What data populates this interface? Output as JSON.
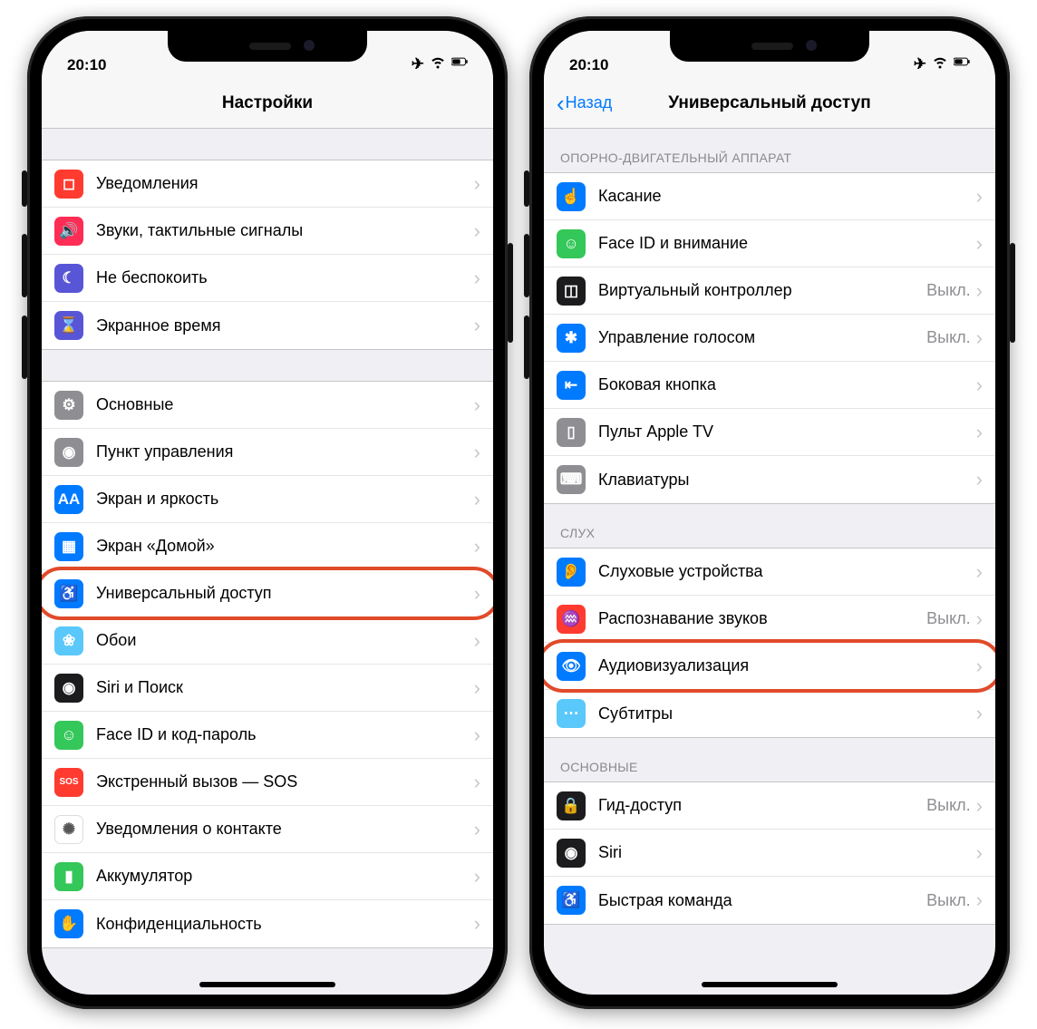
{
  "status": {
    "time": "20:10"
  },
  "left": {
    "nav_title": "Настройки",
    "group1": [
      {
        "icon": "notifications-icon",
        "color": "c-red",
        "label": "Уведомления",
        "glyph": "◻"
      },
      {
        "icon": "sounds-icon",
        "color": "c-pink",
        "label": "Звуки, тактильные сигналы",
        "glyph": "🔊"
      },
      {
        "icon": "dnd-icon",
        "color": "c-purple",
        "label": "Не беспокоить",
        "glyph": "☾"
      },
      {
        "icon": "screentime-icon",
        "color": "c-purple",
        "label": "Экранное время",
        "glyph": "⌛"
      }
    ],
    "group2": [
      {
        "icon": "general-icon",
        "color": "c-gray",
        "label": "Основные",
        "glyph": "⚙"
      },
      {
        "icon": "control-center-icon",
        "color": "c-gray",
        "label": "Пункт управления",
        "glyph": "◉"
      },
      {
        "icon": "display-icon",
        "color": "c-blue",
        "label": "Экран и яркость",
        "glyph": "AA"
      },
      {
        "icon": "homescreen-icon",
        "color": "c-blue",
        "label": "Экран «Домой»",
        "glyph": "▦"
      },
      {
        "icon": "accessibility-icon",
        "color": "c-blue",
        "label": "Универсальный доступ",
        "glyph": "♿",
        "circled": true
      },
      {
        "icon": "wallpaper-icon",
        "color": "c-teal",
        "label": "Обои",
        "glyph": "❀"
      },
      {
        "icon": "siri-icon",
        "color": "c-dark",
        "label": "Siri и Поиск",
        "glyph": "◉"
      },
      {
        "icon": "faceid-icon",
        "color": "c-green",
        "label": "Face ID и код-пароль",
        "glyph": "☺"
      },
      {
        "icon": "sos-icon",
        "color": "c-red",
        "label": "Экстренный вызов — SOS",
        "glyph": "SOS"
      },
      {
        "icon": "exposure-icon",
        "color": "c-white",
        "label": "Уведомления о контакте",
        "glyph": "✺"
      },
      {
        "icon": "battery-icon",
        "color": "c-green",
        "label": "Аккумулятор",
        "glyph": "▮"
      },
      {
        "icon": "privacy-icon",
        "color": "c-blue",
        "label": "Конфиденциальность",
        "glyph": "✋"
      }
    ]
  },
  "right": {
    "nav_back": "Назад",
    "nav_title": "Универсальный доступ",
    "section1_header": "Опорно-двигательный аппарат",
    "section1": [
      {
        "icon": "touch-icon",
        "color": "c-blue",
        "label": "Касание",
        "glyph": "☝"
      },
      {
        "icon": "faceid-attention-icon",
        "color": "c-green",
        "label": "Face ID и внимание",
        "glyph": "☺"
      },
      {
        "icon": "switch-control-icon",
        "color": "c-dark",
        "label": "Виртуальный контроллер",
        "value": "Выкл.",
        "glyph": "◫"
      },
      {
        "icon": "voice-control-icon",
        "color": "c-blue",
        "label": "Управление голосом",
        "value": "Выкл.",
        "glyph": "✱"
      },
      {
        "icon": "side-button-icon",
        "color": "c-blue",
        "label": "Боковая кнопка",
        "glyph": "⇤"
      },
      {
        "icon": "apple-tv-remote-icon",
        "color": "c-gray",
        "label": "Пульт Apple TV",
        "glyph": "▯"
      },
      {
        "icon": "keyboards-icon",
        "color": "c-gray",
        "label": "Клавиатуры",
        "glyph": "⌨"
      }
    ],
    "section2_header": "Слух",
    "section2": [
      {
        "icon": "hearing-devices-icon",
        "color": "c-blue",
        "label": "Слуховые устройства",
        "glyph": "👂"
      },
      {
        "icon": "sound-recognition-icon",
        "color": "c-red",
        "label": "Распознавание звуков",
        "value": "Выкл.",
        "glyph": "♒"
      },
      {
        "icon": "audio-visual-icon",
        "color": "c-blue",
        "label": "Аудиовизуализация",
        "glyph": "👁",
        "circled": true
      },
      {
        "icon": "subtitles-icon",
        "color": "c-teal",
        "label": "Субтитры",
        "glyph": "⋯"
      }
    ],
    "section3_header": "Основные",
    "section3": [
      {
        "icon": "guided-access-icon",
        "color": "c-dark",
        "label": "Гид-доступ",
        "value": "Выкл.",
        "glyph": "🔒"
      },
      {
        "icon": "siri-acc-icon",
        "color": "c-dark",
        "label": "Siri",
        "glyph": "◉"
      },
      {
        "icon": "shortcut-icon",
        "color": "c-blue",
        "label": "Быстрая команда",
        "value": "Выкл.",
        "glyph": "♿"
      }
    ]
  }
}
